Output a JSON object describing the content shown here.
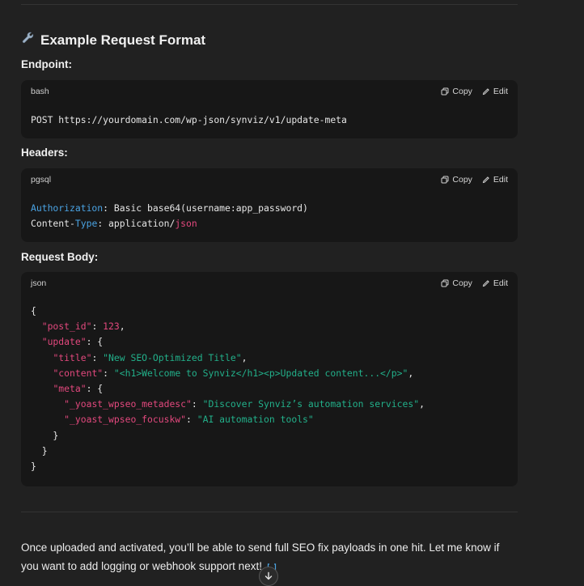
{
  "section": {
    "heading_icon": "wrench-icon",
    "heading": "Example Request Format"
  },
  "endpoint": {
    "label": "Endpoint:",
    "lang": "bash",
    "copy_label": "Copy",
    "edit_label": "Edit",
    "method": "POST",
    "url": "https://yourdomain.com/wp-json/synviz/v1/update-meta"
  },
  "headers": {
    "label": "Headers:",
    "lang": "pgsql",
    "copy_label": "Copy",
    "edit_label": "Edit",
    "auth_key": "Authorization",
    "auth_value": ": Basic base64(username:app_password)",
    "ct_key_a": "Content-",
    "ct_key_b": "Type",
    "ct_value_a": ": application/",
    "ct_value_b": "json"
  },
  "body": {
    "label": "Request Body:",
    "lang": "json",
    "copy_label": "Copy",
    "edit_label": "Edit",
    "post_id_key": "\"post_id\"",
    "post_id_val": "123",
    "update_key": "\"update\"",
    "title_key": "\"title\"",
    "title_val": "\"New SEO-Optimized Title\"",
    "content_key": "\"content\"",
    "content_val": "\"<h1>Welcome to Synviz</h1><p>Updated content...</p>\"",
    "meta_key": "\"meta\"",
    "metadesc_key": "\"_yoast_wpseo_metadesc\"",
    "metadesc_val": "\"Discover Synviz’s automation services\"",
    "focuskw_key": "\"_yoast_wpseo_focuskw\"",
    "focuskw_val": "\"AI automation tools\""
  },
  "message": {
    "text": "Once uploaded and activated, you’ll be able to send full SEO fix payloads in one hit. Let me know if you want to add logging or webhook support next!",
    "trailing_icon": "code-tool-icon"
  },
  "scroll_down_icon": "arrow-down-icon",
  "colors": {
    "background": "#212121",
    "code_background": "#171717",
    "keyword_blue": "#4aa3e3",
    "keyword_red": "#e2487d",
    "string_green": "#22b08a"
  }
}
